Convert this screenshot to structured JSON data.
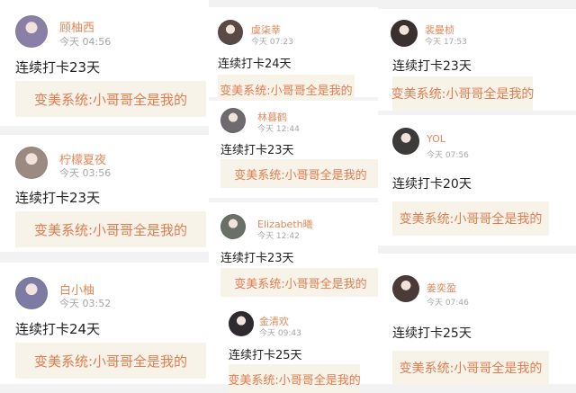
{
  "columns": [
    {
      "posts": [
        {
          "name": "顾柚西",
          "time": "今天 04:56",
          "checkin": "连续打卡23天",
          "book": "变美系统:小哥哥全是我的",
          "avatar_color": "#8a7fa6"
        },
        {
          "name": "柠檬夏夜",
          "time": "今天 03:56",
          "checkin": "连续打卡23天",
          "book": "变美系统:小哥哥全是我的",
          "avatar_color": "#9a8a82"
        },
        {
          "name": "白小柚",
          "time": "今天 03:52",
          "checkin": "连续打卡24天",
          "book": "变美系统:小哥哥全是我的",
          "avatar_color": "#7d7aa3"
        }
      ]
    },
    {
      "posts": [
        {
          "name": "虞柒莘",
          "time": "今天 07:23",
          "checkin": "连续打卡24天",
          "book": "变美系统:小哥哥全是我的",
          "avatar_color": "#5a4a46"
        },
        {
          "name": "林暮鹤",
          "time": "今天 12:44",
          "checkin": "连续打卡23天",
          "book": "变美系统:小哥哥全是我的",
          "avatar_color": "#6f6a6f"
        },
        {
          "name": "Elizabeth曦",
          "time": "今天 12:42",
          "checkin": "连续打卡23天",
          "book": "变美系统:小哥哥全是我的",
          "avatar_color": "#6a7068"
        },
        {
          "name": "金清欢",
          "time": "今天 09:43",
          "checkin": "连续打卡25天",
          "book": "变美系统:小哥哥全是我的",
          "avatar_color": "#2f2a30"
        }
      ]
    },
    {
      "posts": [
        {
          "name": "裴曼桢",
          "time": "今天 17:53",
          "checkin": "连续打卡23天",
          "book": "变美系统:小哥哥全是我的",
          "avatar_color": "#3a3030"
        },
        {
          "name": "YOL",
          "time": "今天 07:56",
          "checkin": "连续打卡20天",
          "book": "变美系统:小哥哥全是我的",
          "avatar_color": "#3d3a3a"
        },
        {
          "name": "姜奕盈",
          "time": "今天 07:46",
          "checkin": "连续打卡25天",
          "book": "变美系统:小哥哥全是我的",
          "avatar_color": "#4a3a38"
        }
      ]
    }
  ]
}
